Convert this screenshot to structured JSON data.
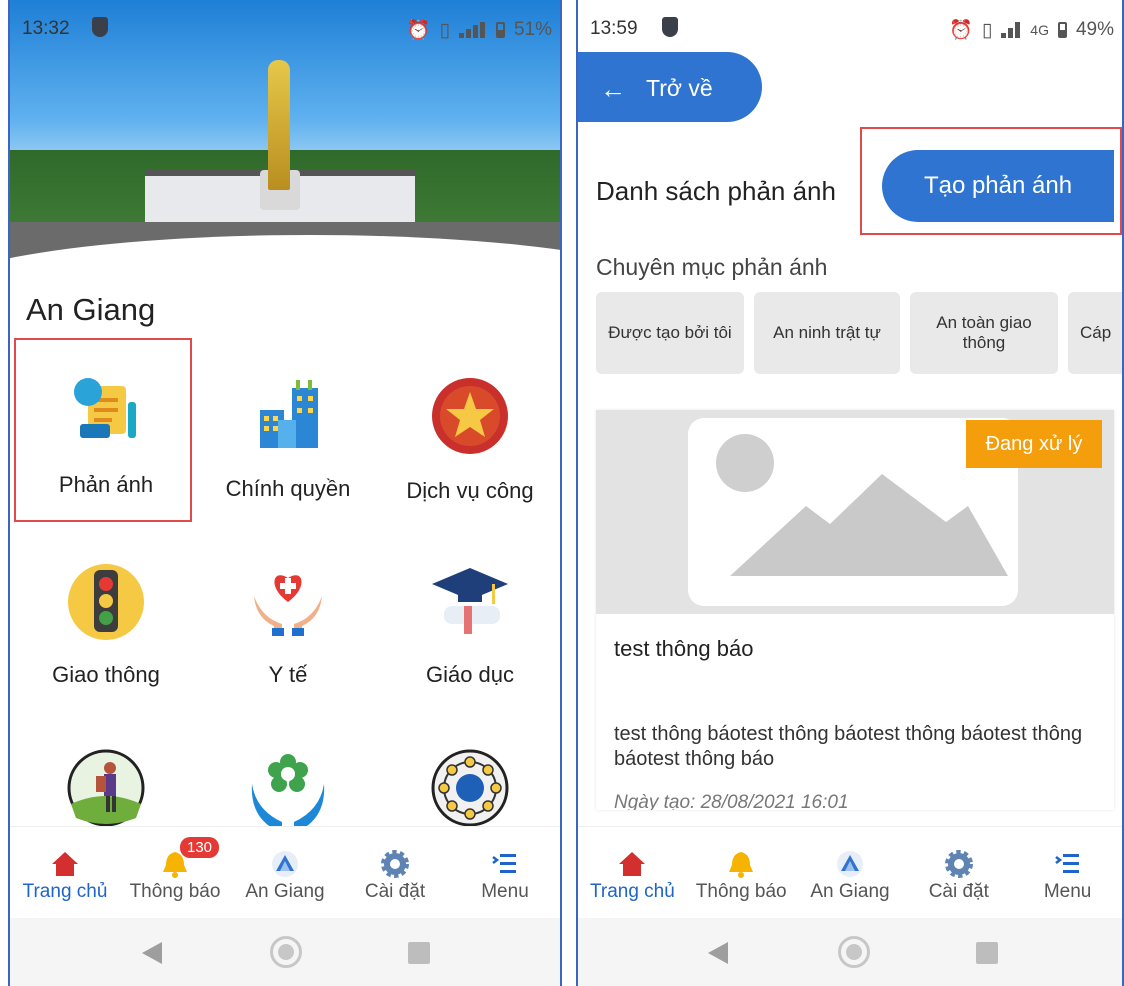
{
  "left": {
    "status_time": "13:32",
    "battery": "51%",
    "section_title": "An Giang",
    "grid": [
      {
        "label": "Phản ánh",
        "icon": "report-document-icon"
      },
      {
        "label": "Chính quyền",
        "icon": "government-buildings-icon"
      },
      {
        "label": "Dịch vụ công",
        "icon": "public-service-star-icon"
      },
      {
        "label": "Giao thông",
        "icon": "traffic-light-icon"
      },
      {
        "label": "Y tế",
        "icon": "healthcare-heart-hands-icon"
      },
      {
        "label": "Giáo dục",
        "icon": "graduation-cap-icon"
      },
      {
        "label": "",
        "icon": "tourism-hiker-icon"
      },
      {
        "label": "",
        "icon": "social-care-hands-icon"
      },
      {
        "label": "",
        "icon": "globe-network-icon"
      }
    ],
    "nav": [
      {
        "label": "Trang chủ",
        "icon": "home-icon"
      },
      {
        "label": "Thông báo",
        "icon": "bell-icon",
        "badge": "130"
      },
      {
        "label": "An Giang",
        "icon": "an-giang-logo-icon"
      },
      {
        "label": "Cài đặt",
        "icon": "gear-icon"
      },
      {
        "label": "Menu",
        "icon": "menu-icon"
      }
    ]
  },
  "right": {
    "status_time": "13:59",
    "battery": "49%",
    "network": "4G",
    "back_label": "Trở về",
    "list_title": "Danh sách phản ánh",
    "create_button": "Tạo phản ánh",
    "category_title": "Chuyên mục phản ánh",
    "categories": [
      "Được tạo bởi tôi",
      "An ninh trật tự",
      "An toàn giao thông",
      "Cáp"
    ],
    "card": {
      "status": "Đang xử lý",
      "title": "test thông báo",
      "description": "test thông báotest thông báotest thông báotest thông báotest thông báo",
      "date": "Ngày tạo: 28/08/2021 16:01"
    },
    "nav": [
      {
        "label": "Trang chủ",
        "icon": "home-icon"
      },
      {
        "label": "Thông báo",
        "icon": "bell-icon"
      },
      {
        "label": "An Giang",
        "icon": "an-giang-logo-icon"
      },
      {
        "label": "Cài đặt",
        "icon": "gear-icon"
      },
      {
        "label": "Menu",
        "icon": "menu-icon"
      }
    ]
  },
  "colors": {
    "primary": "#2f74d0",
    "active_nav": "#1f64c8",
    "highlight_box": "#e04a4a",
    "status_processing": "#f59e0b",
    "badge": "#e53935"
  }
}
